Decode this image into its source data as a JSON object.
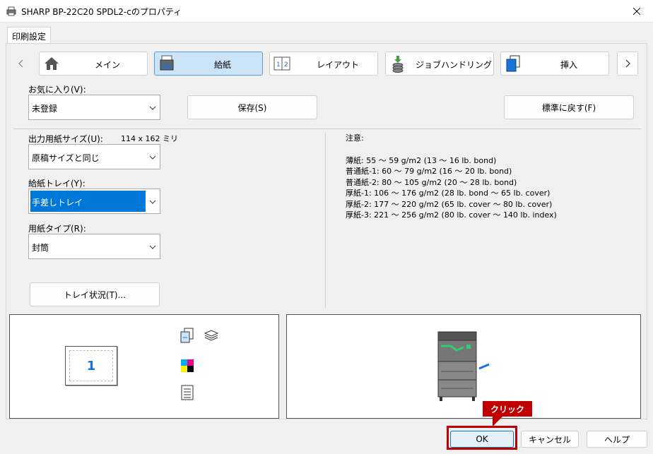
{
  "window": {
    "title": "SHARP BP-22C20 SPDL2-cのプロパティ"
  },
  "tabs": [
    {
      "label": "印刷設定"
    }
  ],
  "nav": {
    "items": [
      {
        "label": "メイン"
      },
      {
        "label": "給紙"
      },
      {
        "label": "レイアウト"
      },
      {
        "label": "ジョブハンドリング"
      },
      {
        "label": "挿入"
      }
    ],
    "selected_index": 1
  },
  "favorites": {
    "label": "お気に入り(V):",
    "value": "未登録",
    "save_label": "保存(S)",
    "reset_label": "標準に戻す(F)"
  },
  "output_size": {
    "label": "出力用紙サイズ(U):",
    "dimensions": "114 x 162 ミリ",
    "value": "原稿サイズと同じ"
  },
  "tray": {
    "label": "給紙トレイ(Y):",
    "value": "手差しトレイ"
  },
  "paper_type": {
    "label": "用紙タイプ(R):",
    "value": "封筒"
  },
  "tray_status_label": "トレイ状況(T)...",
  "notes": {
    "heading": "注意:",
    "lines": [
      "薄紙: 55 ～ 59 g/m2 (13 ～ 16 lb. bond)",
      "普通紙-1: 60 ～ 79 g/m2 (16 ～ 20 lb. bond)",
      "普通紙-2: 80 ～ 105 g/m2 (20 ～ 28 lb. bond)",
      "厚紙-1: 106 ～ 176 g/m2 (28 lb. bond ～ 65 lb. cover)",
      "厚紙-2: 177 ～ 220 g/m2 (65 lb. cover ～ 80 lb. cover)",
      "厚紙-3: 221 ～ 256 g/m2 (80 lb. cover ～ 140 lb. index)"
    ]
  },
  "preview": {
    "page_number": "1"
  },
  "footer": {
    "ok_label": "OK",
    "cancel_label": "キャンセル",
    "help_label": "ヘルプ"
  },
  "callout": {
    "text": "クリック"
  },
  "colors": {
    "accent": "#0078d7",
    "selected_nav": "#cce4f7",
    "callout": "#c00000",
    "printer_green": "#2ecc71"
  }
}
